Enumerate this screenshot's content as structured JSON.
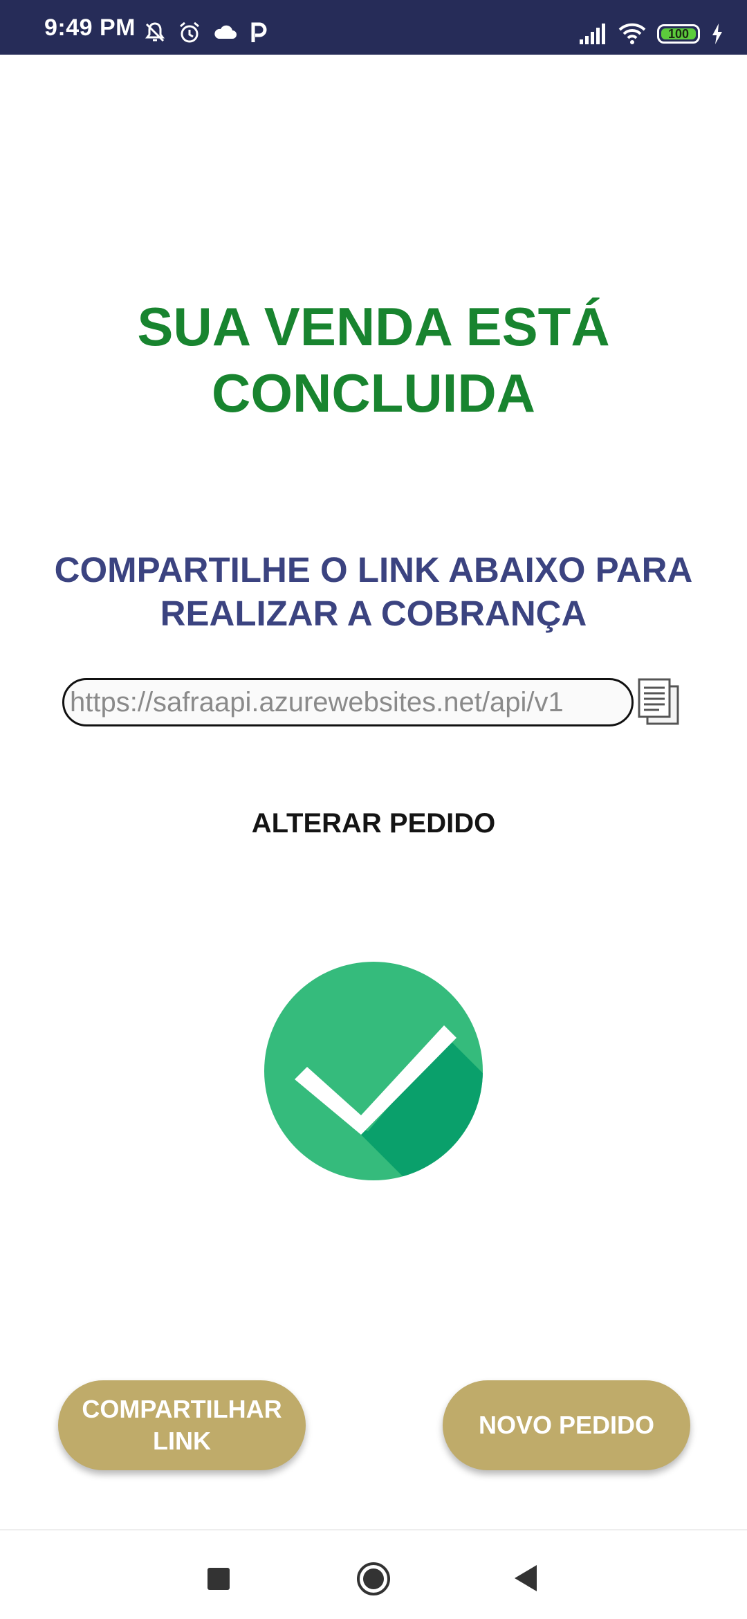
{
  "status_bar": {
    "time": "9:49 PM",
    "battery_level": "100",
    "battery_fraction": 1.0,
    "icons": [
      "notifications-off-icon",
      "alarm-icon",
      "cloud-icon",
      "parking-app-icon",
      "signal-icon",
      "wifi-icon",
      "battery-icon",
      "charging-icon"
    ]
  },
  "main": {
    "title": "SUA VENDA ESTÁ CONCLUIDA",
    "subtitle": "COMPARTILHE O LINK ABAIXO PARA REALIZAR A COBRANÇA",
    "link_value": "https://safraapi.azurewebsites.net/api/v1",
    "alter_order_label": "ALTERAR PEDIDO"
  },
  "buttons": {
    "share_link_label": "COMPARTILHAR LINK",
    "new_order_label": "NOVO PEDIDO"
  },
  "colors": {
    "status_bar": "#262c58",
    "title": "#18842f",
    "subtitle": "#3b4380",
    "button": "#bfab6a",
    "check_light": "#35bb7c",
    "check_dark": "#0aa06b"
  }
}
